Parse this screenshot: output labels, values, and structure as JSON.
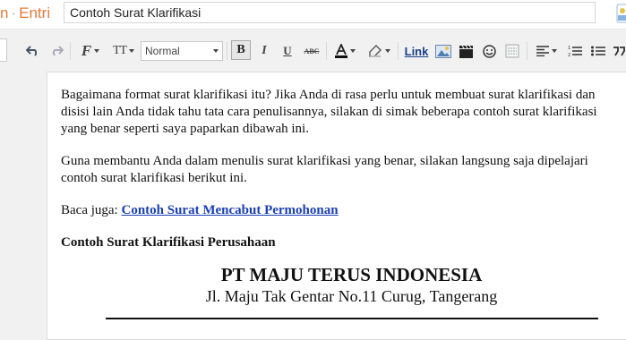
{
  "header": {
    "breadcrumb_prefix": "n",
    "breadcrumb_separator": "·",
    "breadcrumb_section": "Entri",
    "post_title": "Contoh Surat Klarifikasi"
  },
  "toolbar": {
    "style_value": "Normal",
    "bold_label": "B",
    "italic_label": "I",
    "underline_label": "U",
    "strike_label": "ABC",
    "font_size_label": "TT",
    "font_family_label": "F",
    "link_label": "Link"
  },
  "content": {
    "paragraph1": [
      "Bagaimana format surat klarifikasi itu? Jika Anda di rasa perlu untuk membuat surat klarifikasi dan",
      "disisi lain Anda tidak tahu tata cara penulisannya, silakan di simak beberapa contoh surat klarifikasi",
      "yang benar seperti saya paparkan dibawah ini."
    ],
    "paragraph2": [
      "Guna membantu Anda dalam menulis surat klarifikasi yang benar, silakan langsung saja dipelajari",
      "contoh surat klarifikasi berikut ini."
    ],
    "read_also_prefix": "Baca juga: ",
    "read_also_link": "Contoh Surat Mencabut Permohonan",
    "section_heading": "Contoh Surat Klarifikasi Perusahaan",
    "company_name": "PT MAJU TERUS INDONESIA",
    "company_address": "Jl. Maju Tak Gentar No.11 Curug, Tangerang"
  },
  "colors": {
    "breadcrumb": "#e67a3a",
    "link": "#1a3fb5",
    "toolbar_bg": "#f1f1f1"
  }
}
